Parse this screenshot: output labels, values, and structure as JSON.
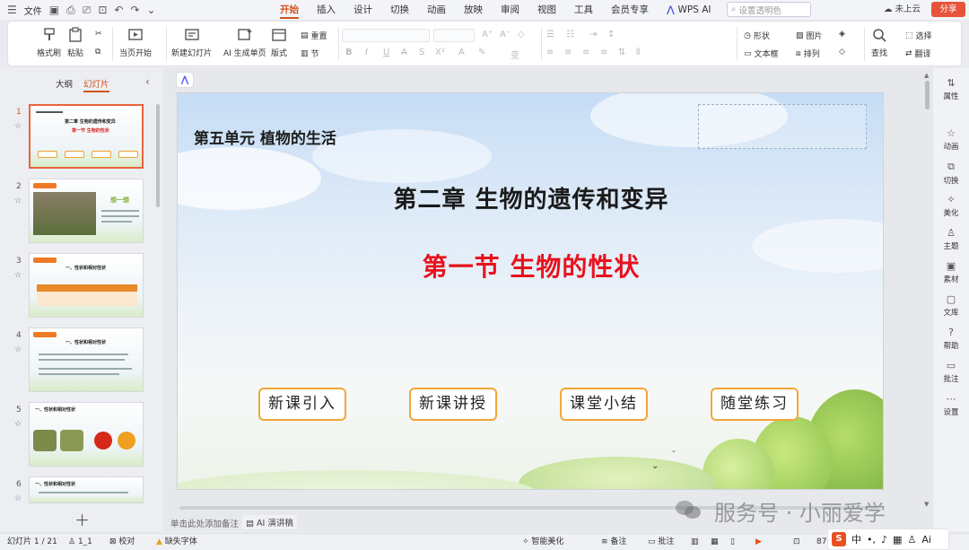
{
  "titlebar": {
    "menu_label": "文件",
    "tabs": [
      "开始",
      "插入",
      "设计",
      "切换",
      "动画",
      "放映",
      "审阅",
      "视图",
      "工具",
      "会员专享",
      "WPS AI"
    ],
    "active_tab": "开始",
    "search_placeholder": "设置透明色",
    "cloud_label": "未上云",
    "share_label": "分享"
  },
  "ribbon": {
    "format_painter": "格式刷",
    "paste": "粘贴",
    "from_current": "当页开始",
    "new_slide": "新建幻灯片",
    "ai_single": "AI 生成单页",
    "layout": "版式",
    "reset": "重置",
    "section": "节",
    "bold": "B",
    "italic": "I",
    "underline": "U",
    "strike": "A",
    "shadow": "S",
    "superscript": "X²",
    "font_color": "A",
    "grow": "A⁺",
    "shrink": "A⁻",
    "clear": "◇",
    "pinyin": "变",
    "shape": "形状",
    "picture": "图片",
    "textbox": "文本框",
    "arrange": "排列",
    "find": "查找",
    "select": "选择",
    "translate": "翻译"
  },
  "leftpanel": {
    "tab_outline": "大纲",
    "tab_slides": "幻灯片",
    "slides": [
      {
        "num": "1",
        "title": "第二章 生物的遗传和变异",
        "subtitle": "第一节 生物的性状"
      },
      {
        "num": "2",
        "title": "想一想"
      },
      {
        "num": "3",
        "title": "一、性状和相对性状"
      },
      {
        "num": "4",
        "title": "一、性状和相对性状"
      },
      {
        "num": "5",
        "title": "一、性状和相对性状"
      },
      {
        "num": "6",
        "title": "一、性状和相对性状"
      }
    ]
  },
  "slide": {
    "unit": "第五单元  植物的生活",
    "chapter": "第二章  生物的遗传和变异",
    "section": "第一节  生物的性状",
    "buttons": [
      "新课引入",
      "新课讲授",
      "课堂小结",
      "随堂练习"
    ]
  },
  "editor": {
    "notes_placeholder": "单击此处添加备注",
    "ai_lecture": "AI 演讲稿"
  },
  "rightbar": [
    "属性",
    "动画",
    "切换",
    "美化",
    "主题",
    "素材",
    "文库",
    "帮助",
    "批注",
    "设置"
  ],
  "statusbar": {
    "slide_count": "幻灯片 1 / 21",
    "theme": "1_1",
    "proofread": "校对",
    "missing_font": "缺失字体",
    "smart_beautify": "智能美化",
    "notes": "备注",
    "comments": "批注",
    "zoom": "87"
  },
  "ime": {
    "lang": "中",
    "ai": "Ai"
  },
  "watermark": "服务号 · 小丽爱学",
  "colors": {
    "accent": "#d2541e",
    "section_red": "#e8121e",
    "button_border": "#f2a63a"
  }
}
